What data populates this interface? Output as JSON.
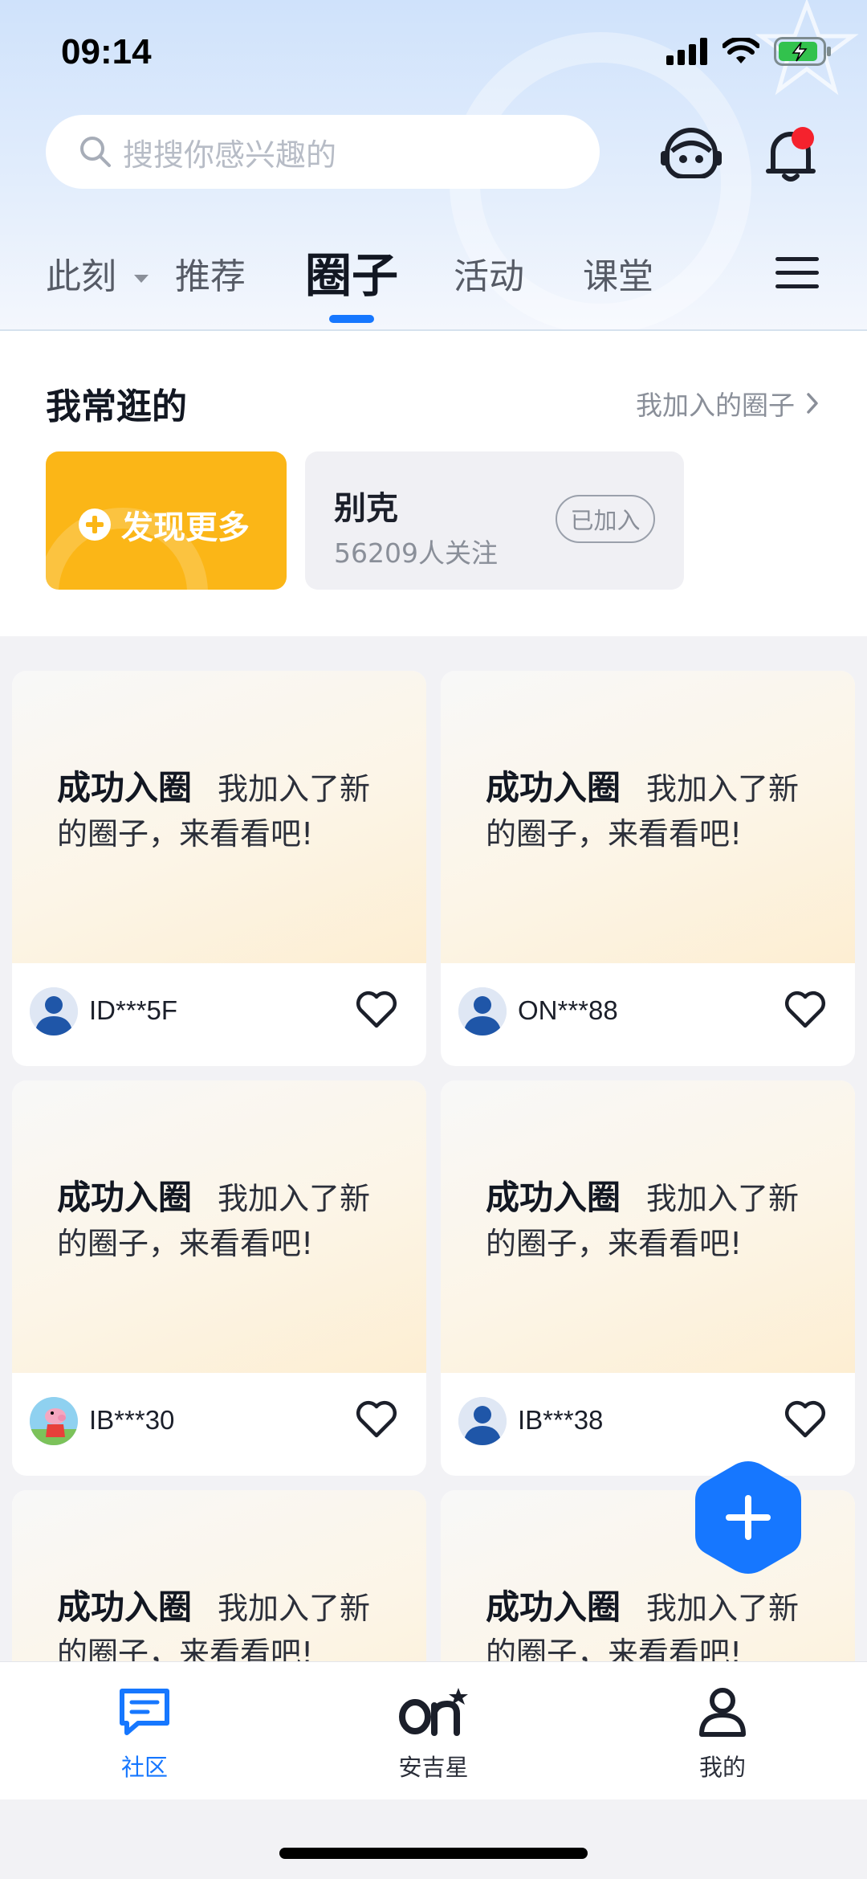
{
  "status_bar": {
    "time": "09:14"
  },
  "search": {
    "placeholder": "搜搜你感兴趣的"
  },
  "tabs": [
    {
      "label": "此刻",
      "has_dropdown": true
    },
    {
      "label": "推荐"
    },
    {
      "label": "圈子",
      "active": true
    },
    {
      "label": "活动"
    },
    {
      "label": "课堂"
    }
  ],
  "frequent": {
    "title": "我常逛的",
    "link": "我加入的圈子",
    "discover_label": "发现更多",
    "circle": {
      "name": "别克",
      "followers": "56209人关注",
      "badge": "已加入"
    }
  },
  "feed": [
    {
      "headline": "成功入圈",
      "text": "我加入了新的圈子，来看看吧!",
      "user": "ID***5F",
      "avatar": "default"
    },
    {
      "headline": "成功入圈",
      "text": "我加入了新的圈子，来看看吧!",
      "user": "ON***88",
      "avatar": "default"
    },
    {
      "headline": "成功入圈",
      "text": "我加入了新的圈子，来看看吧!",
      "user": "IB***30",
      "avatar": "cartoon"
    },
    {
      "headline": "成功入圈",
      "text": "我加入了新的圈子，来看看吧!",
      "user": "IB***38",
      "avatar": "default"
    },
    {
      "headline": "成功入圈",
      "text": "我加入了新的圈子，来看看吧!",
      "user": "",
      "avatar": ""
    },
    {
      "headline": "成功入圈",
      "text": "我加入了新的圈子，来看看吧!",
      "user": "",
      "avatar": ""
    }
  ],
  "bottom_nav": [
    {
      "label": "社区",
      "icon": "chat-bubble-icon",
      "active": true
    },
    {
      "label": "安吉星",
      "icon": "onstar-logo-icon"
    },
    {
      "label": "我的",
      "icon": "user-icon"
    }
  ],
  "colors": {
    "accent": "#1677ff",
    "discover": "#fbb617",
    "notification_dot": "#f5222d"
  }
}
